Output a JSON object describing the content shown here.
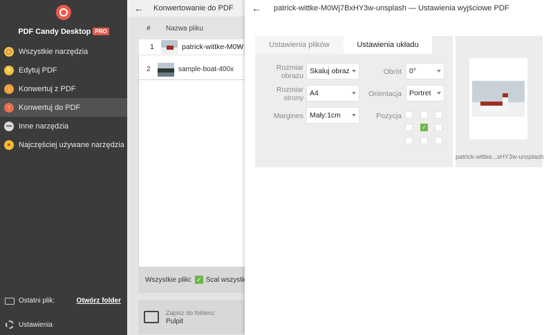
{
  "app": {
    "brand": "PDF Candy Desktop",
    "badge": "PRO",
    "accent": "#e05b4f"
  },
  "sidebar": {
    "items": [
      {
        "label": "Wszystkie narzędzia",
        "icon": "candy-icon",
        "active": false
      },
      {
        "label": "Edytuj PDF",
        "icon": "edit-icon",
        "active": false
      },
      {
        "label": "Konwertuj z PDF",
        "icon": "convert-from-icon",
        "active": false
      },
      {
        "label": "Konwertuj do PDF",
        "icon": "convert-to-icon",
        "active": true
      },
      {
        "label": "Inne narzędzia",
        "icon": "more-icon",
        "active": false
      },
      {
        "label": "Najczęściej używane narzędzia",
        "icon": "star-icon",
        "active": false
      }
    ],
    "last_file_label": "Ostatni plik:",
    "open_folder_link": "Otwórz folder",
    "settings_label": "Ustawienia"
  },
  "middle": {
    "title": "Konwertowanie do PDF",
    "col_num": "#",
    "col_name": "Nazwa pliku",
    "files": [
      {
        "num": "1",
        "name": "patrick-wittke-M0W",
        "thumb": "church"
      },
      {
        "num": "2",
        "name": "sample-boat-400x",
        "thumb": "boat"
      }
    ],
    "all_files_label": "Wszystkie pliki:",
    "merge_label": "Scal wszystko w",
    "save_to_label": "Zapisz do folderu:",
    "save_to_value": "Pulpit"
  },
  "dialog": {
    "title": "patrick-wittke-M0Wj7BxHY3w-unsplash — Ustawienia wyjściowe PDF",
    "tabs": {
      "files": "Ustawienia plików",
      "layout": "Ustawienia układu"
    },
    "image_size_label_1": "Rozmiar",
    "image_size_label_2": "obrazu",
    "image_size_value": "Skaluj obraz",
    "page_size_label_1": "Rozmiar",
    "page_size_label_2": "strony",
    "page_size_value": "A4",
    "margins_label": "Margines",
    "margins_value": "Mały:1cm",
    "rotation_label": "Obrót",
    "rotation_value": "0°",
    "orientation_label": "Orientacja",
    "orientation_value": "Portret",
    "position_label": "Pozycja",
    "position_selected": "center",
    "preview_name": "patrick-wittke...xHY3w-unsplash"
  }
}
